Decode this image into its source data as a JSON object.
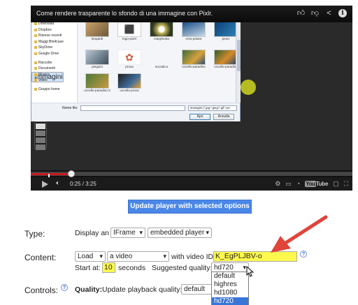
{
  "video": {
    "title": "Come rendere trasparente lo sfondo di una immagine con Pixlr.",
    "top_icons": [
      "thumbs-up-icon",
      "thumbs-down-icon",
      "share-icon",
      "info-icon"
    ],
    "time": "0:25 / 3:25",
    "progress": 0.125,
    "logo_text": "You",
    "logo_tube": "Tube",
    "controls_right": [
      "gear-icon",
      "captions-icon",
      "youtube-logo",
      "theater-icon",
      "fullscreen-icon"
    ]
  },
  "dialog": {
    "sidebar": [
      "Download",
      "Dropbox",
      "Risorse recenti",
      "Maggi Briefcase",
      "SkyDrive",
      "Google Drive",
      "Raccolte",
      "Documenti",
      "Immagini",
      "Musica",
      "Video",
      "Gruppo home"
    ],
    "sidebar_selected": "Immagini",
    "files": [
      {
        "name": "leopardi"
      },
      {
        "name": "logo-pixel"
      },
      {
        "name": "margherita"
      },
      {
        "name": "orso-polare"
      },
      {
        "name": "pesci"
      },
      {
        "name": "pinguini"
      },
      {
        "name": "prova"
      },
      {
        "name": "socratico"
      },
      {
        "name": "uccello-paradiso"
      },
      {
        "name": "uccello-paradiso"
      },
      {
        "name": "uccello-paradiso-2"
      },
      {
        "name": "uccello-prova"
      }
    ],
    "filename_label": "Nome file:",
    "filter": "Immagini (*.jpg;*.jpeg;*.gif;*.pn",
    "open_label": "Apri",
    "cancel_label": "Annulla"
  },
  "update_button": "Update player with selected options",
  "form": {
    "type_label": "Type:",
    "display_an": "Display an",
    "type_select": "IFrame",
    "embed_select": "embedded player",
    "content_label": "Content:",
    "load_select": "Load",
    "video_select": "a video",
    "with_video_id": "with video ID",
    "video_id": "K_EgPLJBV-o",
    "start_at": "Start at:",
    "start_value": "10",
    "seconds": "seconds",
    "suggested_quality": "Suggested quality:",
    "quality_value": "hd720",
    "quality_options": [
      "default",
      "highres",
      "hd1080",
      "hd720"
    ],
    "quality_active": "hd720",
    "controls_label": "Controls:",
    "quality_bold": "Quality:",
    "update_quality": "Update playback quality:",
    "update_quality_value": "default"
  },
  "colors": {
    "accent_button": "#4a87e8",
    "highlight": "#fff94d",
    "arrow": "#e0443a",
    "progress": "#cc181e",
    "selection": "#3875d7"
  }
}
